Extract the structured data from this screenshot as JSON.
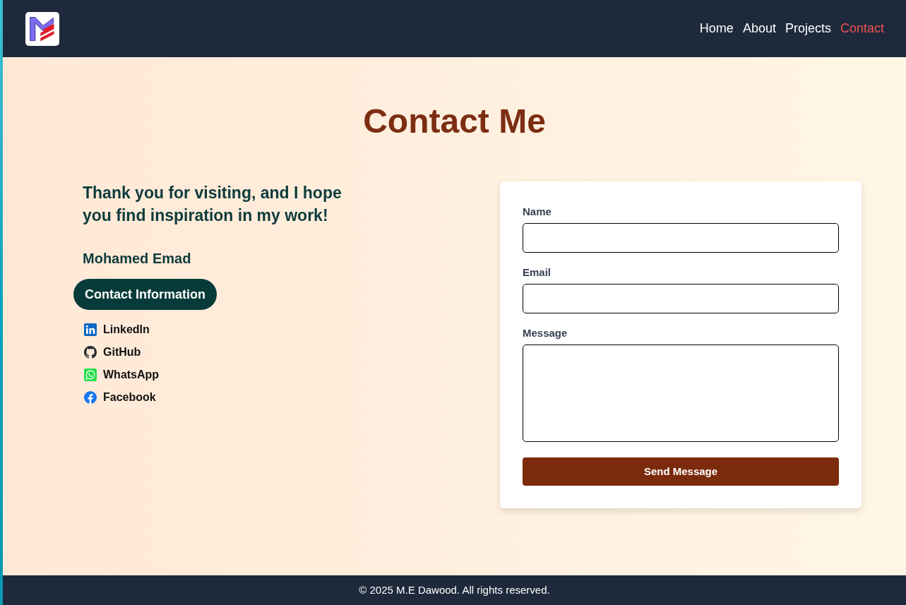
{
  "nav": [
    {
      "label": "Home",
      "selected": false
    },
    {
      "label": "About",
      "selected": false
    },
    {
      "label": "Projects",
      "selected": false
    },
    {
      "label": "Contact",
      "selected": true
    }
  ],
  "page_title": "Contact Me",
  "intro": {
    "message": "Thank you for visiting, and I hope you find inspiration in my work!",
    "name": "Mohamed Emad",
    "contact_button": "Contact Information",
    "links": [
      {
        "kind": "linkedin",
        "label": "LinkedIn"
      },
      {
        "kind": "github",
        "label": "GitHub"
      },
      {
        "kind": "whatsapp",
        "label": "WhatsApp"
      },
      {
        "kind": "facebook",
        "label": "Facebook"
      }
    ]
  },
  "form": {
    "fields": [
      {
        "kind": "input",
        "label": "Name"
      },
      {
        "kind": "input",
        "label": "Email"
      },
      {
        "kind": "textarea",
        "label": "Message"
      }
    ],
    "submit": "Send Message"
  },
  "footer": {
    "copyright": "© 2025 M.E Dawood. All rights reserved."
  }
}
